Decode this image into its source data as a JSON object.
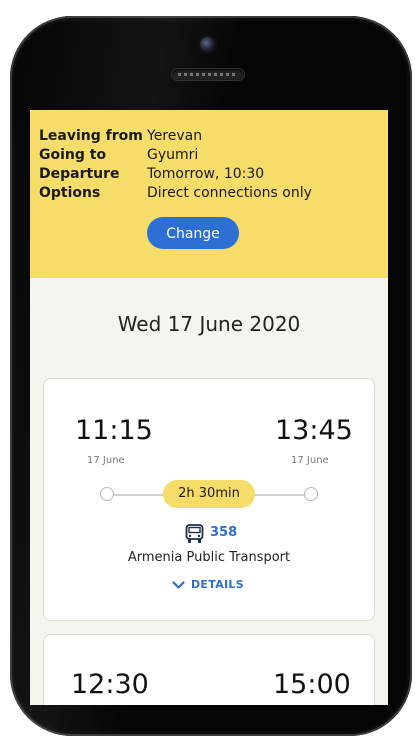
{
  "search": {
    "leaving_from_label": "Leaving from",
    "leaving_from_value": "Yerevan",
    "going_to_label": "Going to",
    "going_to_value": "Gyumri",
    "departure_label": "Departure",
    "departure_value": "Tomorrow, 10:30",
    "options_label": "Options",
    "options_value": "Direct connections only",
    "change_button": "Change"
  },
  "results": {
    "date_heading": "Wed 17 June 2020",
    "trips": [
      {
        "depart_time": "11:15",
        "depart_date": "17 June",
        "arrive_time": "13:45",
        "arrive_date": "17 June",
        "duration": "2h 30min",
        "route_number": "358",
        "operator": "Armenia Public Transport",
        "details_label": "DETAILS"
      },
      {
        "depart_time": "12:30",
        "arrive_time": "15:00"
      }
    ]
  },
  "icons": {
    "transport": "bus-icon",
    "expand": "chevron-down-icon"
  },
  "colors": {
    "accent_yellow": "#f6dd6a",
    "accent_blue": "#2d6fd2",
    "background": "#f5f5ef"
  }
}
